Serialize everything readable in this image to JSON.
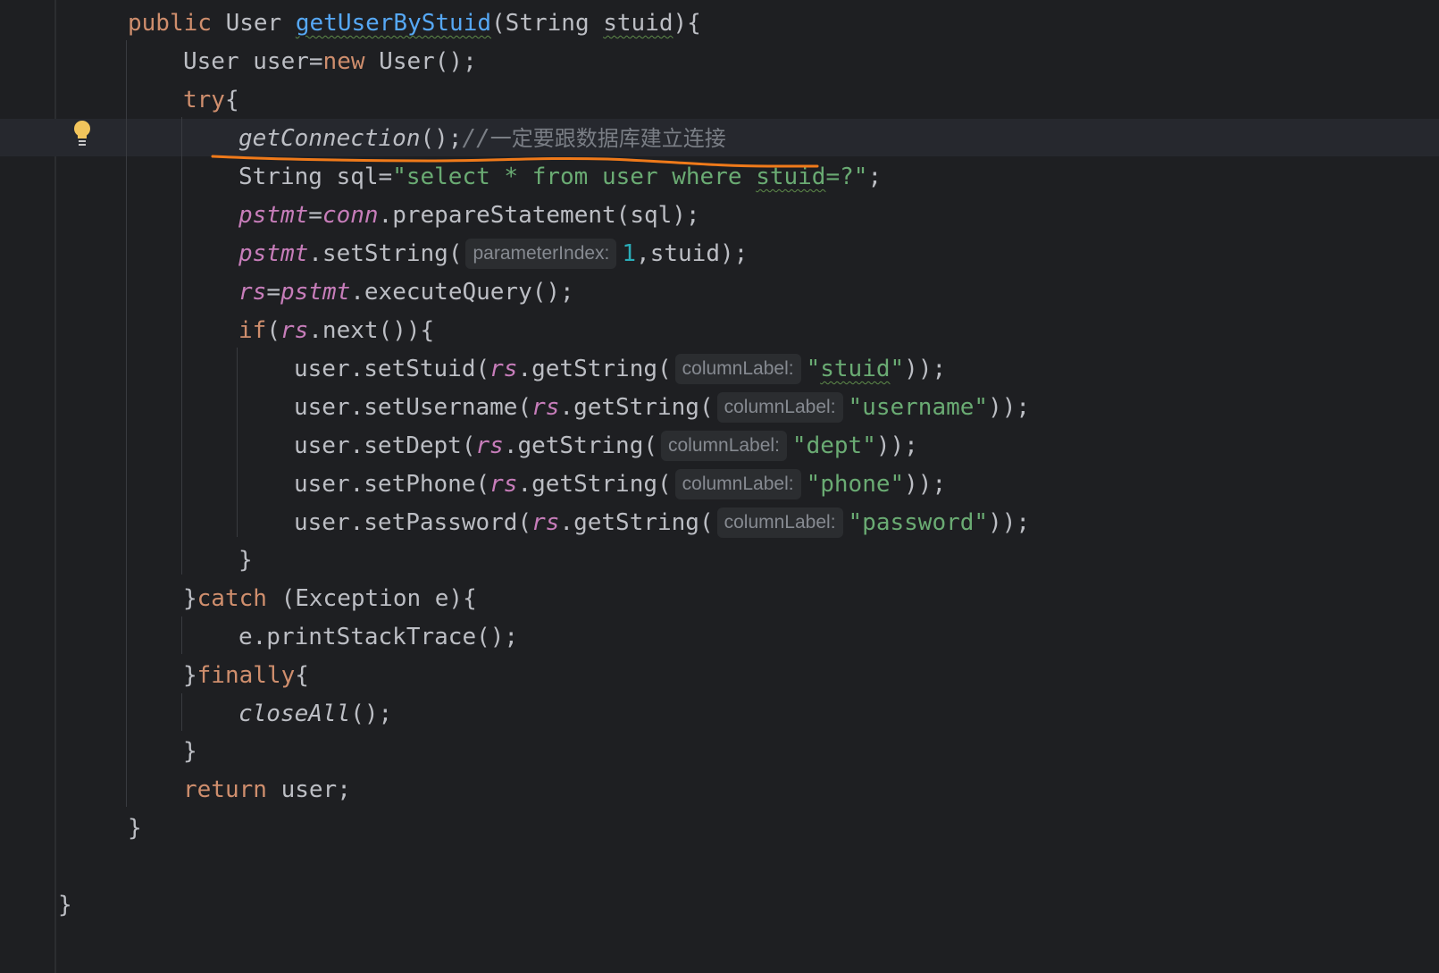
{
  "editor": {
    "lines": {
      "l1": {
        "kw_public": "public",
        "type_user": "User",
        "method_name": "getUserByStuid",
        "open": "(",
        "type_string": "String",
        "param": "stuid",
        "close": "){"
      },
      "l2": {
        "decl": "User user=",
        "kw_new": "new",
        "rest": " User();"
      },
      "l3": {
        "kw_try": "try",
        "brace": "{"
      },
      "l4": {
        "call": "getConnection",
        "rest": "();",
        "comment_prefix": "//",
        "comment_text": "一定要跟数据库建立连接"
      },
      "l5": {
        "decl": "String sql=",
        "str_a": "\"select * from user where ",
        "str_b": "stuid",
        "str_c": "=?\"",
        "end": ";"
      },
      "l6": {
        "v1": "pstmt",
        "eq": "=",
        "v2": "conn",
        "rest": ".prepareStatement(sql);"
      },
      "l7": {
        "v1": "pstmt",
        "rest1": ".setString(",
        "hint": "parameterIndex:",
        "num": "1",
        "rest2": ",stuid);"
      },
      "l8": {
        "v1": "rs",
        "eq": "=",
        "v2": "pstmt",
        "rest": ".executeQuery();"
      },
      "l9": {
        "kw_if": "if",
        "open": "(",
        "v": "rs",
        "rest": ".next()){"
      },
      "l10": {
        "pre": "user.setStuid(",
        "v": "rs",
        "mid": ".getString(",
        "hint": "columnLabel:",
        "q1": "\"",
        "arg": "stuid",
        "q2": "\"",
        "end": "));"
      },
      "l11": {
        "pre": "user.setUsername(",
        "v": "rs",
        "mid": ".getString(",
        "hint": "columnLabel:",
        "arg": "\"username\"",
        "end": "));"
      },
      "l12": {
        "pre": "user.setDept(",
        "v": "rs",
        "mid": ".getString(",
        "hint": "columnLabel:",
        "arg": "\"dept\"",
        "end": "));"
      },
      "l13": {
        "pre": "user.setPhone(",
        "v": "rs",
        "mid": ".getString(",
        "hint": "columnLabel:",
        "arg": "\"phone\"",
        "end": "));"
      },
      "l14": {
        "pre": "user.setPassword(",
        "v": "rs",
        "mid": ".getString(",
        "hint": "columnLabel:",
        "arg": "\"password\"",
        "end": "));"
      },
      "l15": {
        "text": "}"
      },
      "l16": {
        "brace": "}",
        "kw_catch": "catch",
        "rest": " (Exception e){"
      },
      "l17": {
        "text": "e.printStackTrace();"
      },
      "l18": {
        "brace": "}",
        "kw_finally": "finally",
        "open": "{"
      },
      "l19": {
        "call": "closeAll",
        "rest": "();"
      },
      "l20": {
        "text": "}"
      },
      "l21": {
        "kw_return": "return",
        "rest": " user;"
      },
      "l22": {
        "text": "}"
      },
      "l23": {
        "text": "}"
      }
    },
    "icons": {
      "gutter_bulb": "lightbulb-icon"
    },
    "annotation": {
      "color": "#f07a1a"
    },
    "colors": {
      "background": "#1e1f22",
      "keyword": "#cf8e6d",
      "method_decl": "#56a8f5",
      "string": "#6aab73",
      "number": "#2aacb8",
      "field": "#c77dba",
      "comment": "#7a7e85"
    }
  }
}
